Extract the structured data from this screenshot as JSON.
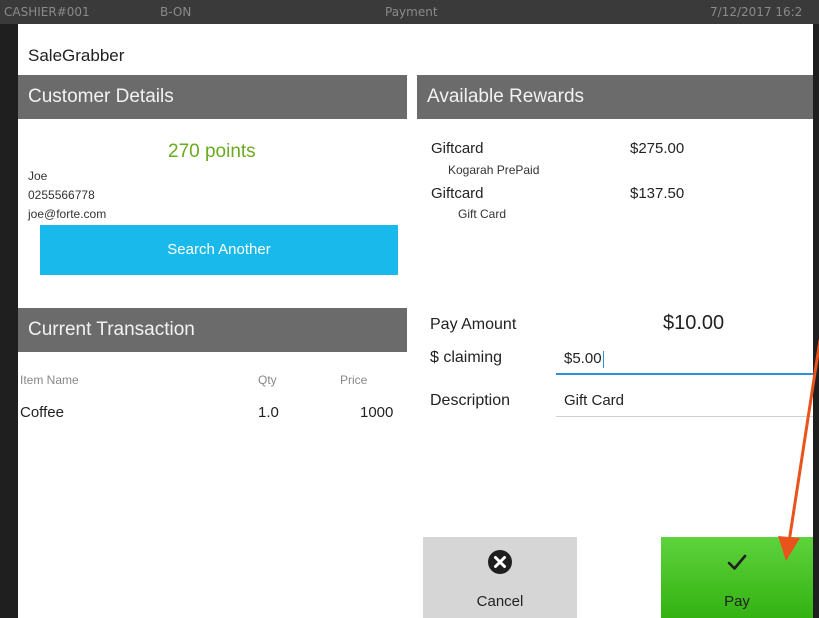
{
  "topbar": {
    "cashier": "CASHIER#001",
    "status": "B-ON",
    "screen": "Payment",
    "datetime": "7/12/2017 16:2"
  },
  "dialog": {
    "title": "SaleGrabber",
    "customer": {
      "header": "Customer Details",
      "points": "270 points",
      "name": "Joe",
      "phone": "0255566778",
      "email": "joe@forte.com",
      "search_label": "Search Another"
    },
    "transaction": {
      "header": "Current Transaction",
      "columns": [
        "Item Name",
        "Qty",
        "Price"
      ],
      "rows": [
        {
          "name": "Coffee",
          "qty": "1.0",
          "price": "1000"
        }
      ]
    },
    "rewards": {
      "header": "Available Rewards",
      "items": [
        {
          "name": "Giftcard",
          "sub": "Kogarah PrePaid",
          "value": "$275.00"
        },
        {
          "name": "Giftcard",
          "sub": "Gift Card",
          "value": "$137.50"
        }
      ]
    },
    "payment": {
      "pay_amount_label": "Pay Amount",
      "pay_amount": "$10.00",
      "claiming_label": "$ claiming",
      "claiming_value": "$5.00",
      "description_label": "Description",
      "description_value": "Gift Card"
    },
    "buttons": {
      "cancel": "Cancel",
      "pay": "Pay"
    }
  },
  "colors": {
    "accent_blue": "#1ab9ec",
    "points_green": "#6aab1f",
    "pay_green": "#4cc22a",
    "header_gray": "#6b6b6b",
    "annotation_orange": "#e8541c"
  },
  "icons": [
    "close-circle-icon",
    "checkmark-icon",
    "arrow-annotation"
  ]
}
